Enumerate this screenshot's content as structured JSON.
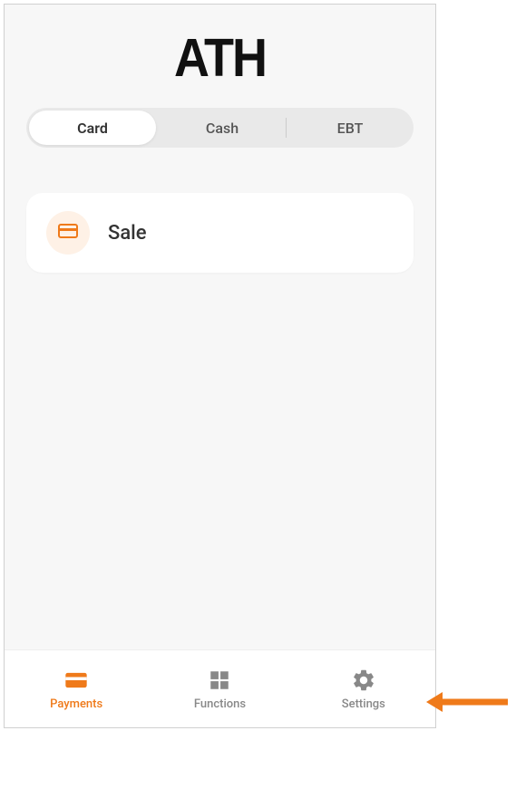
{
  "header": {
    "logo": "ATH"
  },
  "tabs": {
    "items": [
      {
        "label": "Card",
        "active": true
      },
      {
        "label": "Cash",
        "active": false
      },
      {
        "label": "EBT",
        "active": false
      }
    ]
  },
  "content": {
    "sale": {
      "label": "Sale",
      "icon": "card-icon"
    }
  },
  "bottomNav": {
    "items": [
      {
        "label": "Payments",
        "icon": "card-icon",
        "active": true
      },
      {
        "label": "Functions",
        "icon": "grid-icon",
        "active": false
      },
      {
        "label": "Settings",
        "icon": "gear-icon",
        "active": false
      }
    ]
  },
  "colors": {
    "accent": "#ef7a1a",
    "inactive": "#888"
  }
}
